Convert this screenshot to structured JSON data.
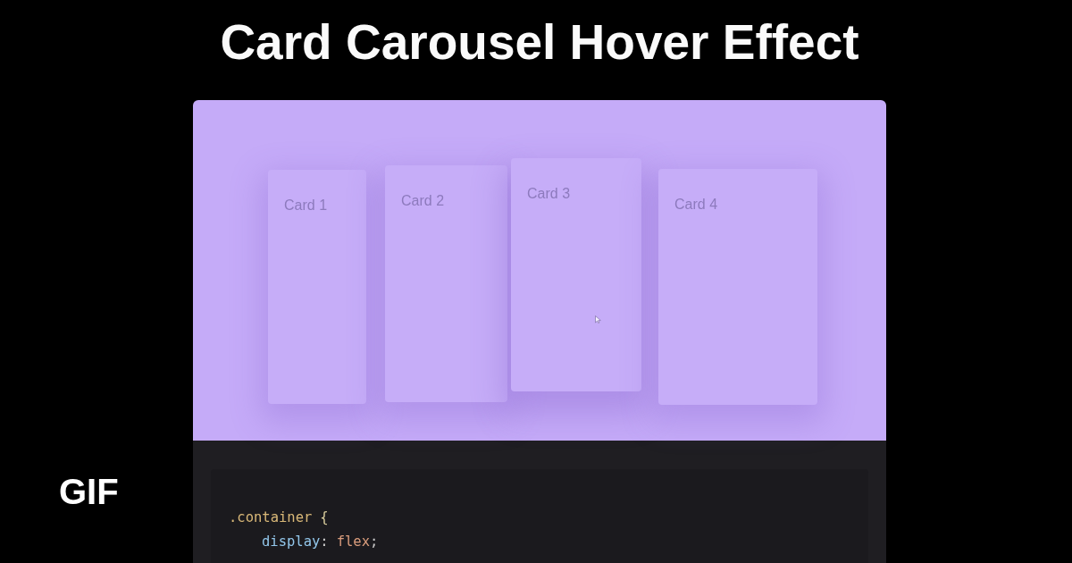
{
  "page": {
    "title": "Card Carousel Hover Effect",
    "badge": "GIF"
  },
  "demo": {
    "cards": [
      {
        "label": "Card 1",
        "hovered": false
      },
      {
        "label": "Card 2",
        "hovered": false
      },
      {
        "label": "Card 3",
        "hovered": true
      },
      {
        "label": "Card 4",
        "hovered": false
      }
    ]
  },
  "code": {
    "lines": [
      {
        "kind": "rule",
        "tokens": [
          {
            "kind": "selector",
            "text": ".container"
          },
          {
            "kind": "brace",
            "text": "{"
          }
        ]
      },
      {
        "kind": "declaration",
        "tokens": [
          {
            "kind": "property",
            "text": "display"
          },
          {
            "kind": "colon",
            "text": ":"
          },
          {
            "kind": "value",
            "text": "flex"
          },
          {
            "kind": "semicolon",
            "text": ";"
          }
        ]
      }
    ]
  }
}
